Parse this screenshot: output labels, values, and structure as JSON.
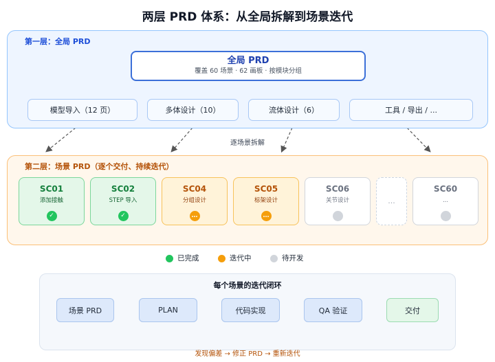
{
  "title": "两层 PRD 体系：从全局拆解到场景迭代",
  "layer1": {
    "label": "第一层：全局 PRD",
    "global_title": "全局 PRD",
    "global_subtitle": "覆盖 60 场景 · 62 画板 · 按模块分组",
    "modules": [
      "模型导入（12 页）",
      "多体设计（10）",
      "流体设计（6）",
      "工具 / 导出 / ..."
    ]
  },
  "split_label": "逐场景拆解",
  "layer2": {
    "label": "第二层：场景 PRD（逐个交付、持续迭代）",
    "scenes": [
      {
        "code": "SC01",
        "name": "添加接触",
        "status": "done",
        "icon": "check-icon"
      },
      {
        "code": "SC02",
        "name": "STEP 导入",
        "status": "done",
        "icon": "check-icon"
      },
      {
        "code": "SC04",
        "name": "分组设计",
        "status": "iterating",
        "icon": "ellipsis-icon"
      },
      {
        "code": "SC05",
        "name": "标架设计",
        "status": "iterating",
        "icon": "ellipsis-icon"
      },
      {
        "code": "SC06",
        "name": "关节设计",
        "status": "todo",
        "icon": "circle-icon"
      },
      {
        "code": "...",
        "name": "",
        "status": "placeholder"
      },
      {
        "code": "SC60",
        "name": "...",
        "status": "todo",
        "icon": "circle-icon"
      }
    ]
  },
  "legend": [
    {
      "label": "已完成",
      "color": "#22c55e"
    },
    {
      "label": "迭代中",
      "color": "#f59e0b"
    },
    {
      "label": "待开发",
      "color": "#d1d5db"
    }
  ],
  "loop": {
    "title": "每个场景的迭代闭环",
    "steps": [
      "场景 PRD",
      "PLAN",
      "代码实现",
      "QA 验证",
      "交付"
    ],
    "feedback": "发现偏差 → 修正 PRD → 重新迭代"
  },
  "colors": {
    "layer1_border": "#93c5fd",
    "layer2_border": "#fbbf77",
    "done": "#22c55e",
    "iterating": "#f59e0b",
    "todo": "#d1d5db",
    "arrow": "#2563eb",
    "feedback": "#f59e0b"
  }
}
